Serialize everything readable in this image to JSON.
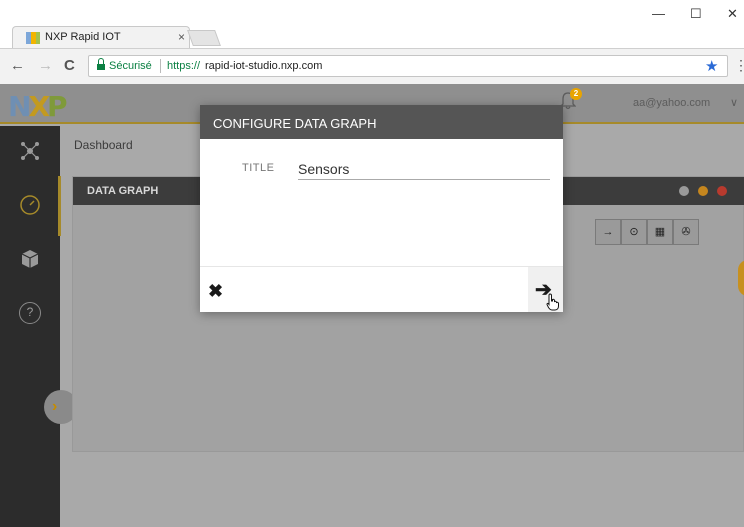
{
  "browser": {
    "tab_title": "NXP Rapid IOT",
    "tab_close_glyph": "×",
    "win_minimize": "—",
    "win_maximize": "☐",
    "win_close": "✕",
    "back_glyph": "←",
    "forward_glyph": "→",
    "reload_glyph": "C",
    "secure_label": "Sécurisé",
    "url_scheme": "https://",
    "url_host": "rapid-iot-studio.nxp.com",
    "star_glyph": "★",
    "menu_glyph": "⋮"
  },
  "topbar": {
    "logo_letters": [
      "N",
      "X",
      "P"
    ],
    "notification_count": "2",
    "user_email": "aa@yahoo.com",
    "chevron_glyph": "∨"
  },
  "sidebar": {
    "icons": [
      "network-icon",
      "dashboard-gauge-icon",
      "cube-icon",
      "help-icon"
    ],
    "help_glyph": "?",
    "collapse_glyph": "›"
  },
  "main": {
    "breadcrumb": "Dashboard",
    "card_title": "DATA GRAPH",
    "toolbar": [
      "→",
      "⊙",
      "▦",
      "✇"
    ]
  },
  "modal": {
    "title": "CONFIGURE DATA GRAPH",
    "field_label": "TITLE",
    "field_value": "Sensors",
    "close_glyph": "✖",
    "next_glyph": "➔"
  },
  "colors": {
    "accent_gold": "#a68a2a",
    "nxp_blue": "#7da7d9",
    "nxp_yellow": "#f2b400",
    "nxp_green": "#a3c24c",
    "secure_green": "#0b8043",
    "modal_header": "#555555"
  }
}
